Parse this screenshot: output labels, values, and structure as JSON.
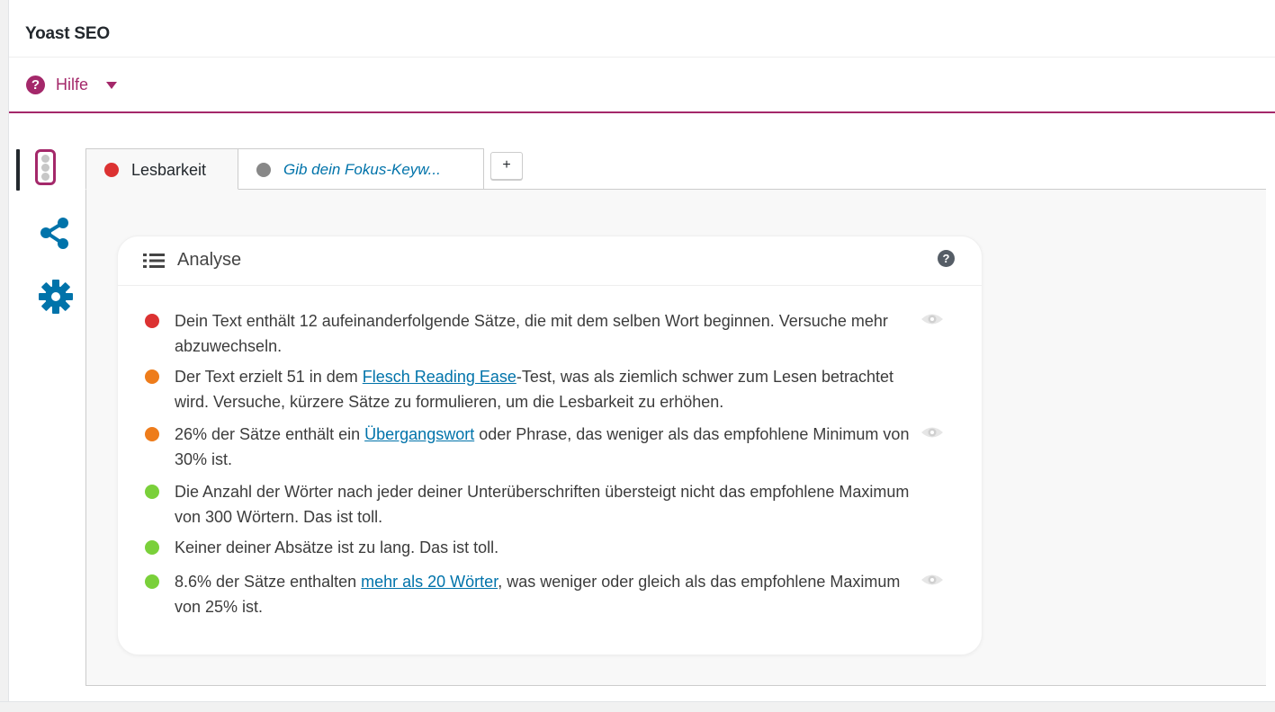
{
  "window": {
    "title": "Yoast SEO"
  },
  "help": {
    "label": "Hilfe",
    "icon": "question-circle-icon"
  },
  "side_nav": {
    "items": [
      {
        "name": "readability-traffic-light-icon",
        "active": true
      },
      {
        "name": "share-icon",
        "active": false
      },
      {
        "name": "gear-icon",
        "active": false
      }
    ]
  },
  "tabs": [
    {
      "label": "Lesbarkeit",
      "status_color": "#dc3232",
      "active": true
    },
    {
      "label": "Gib dein Fokus-Keyw...",
      "status_color": "#888888",
      "active": false
    }
  ],
  "add_tab_label": "+",
  "analysis": {
    "title": "Analyse",
    "help_glyph": "?",
    "results": [
      {
        "status_color": "#dc3232",
        "before": "Dein Text enthält 12 aufeinanderfolgende Sätze, die mit dem selben Wort beginnen. Versuche mehr abzuwechseln.",
        "link": "",
        "after": "",
        "has_eye": true
      },
      {
        "status_color": "#ee7c1b",
        "before": "Der Text erzielt 51 in dem ",
        "link": "Flesch Reading Ease",
        "after": "-Test, was als ziemlich schwer zum Lesen betrachtet wird. Versuche, kürzere Sätze zu formulieren, um die Lesbarkeit zu erhöhen.",
        "has_eye": false
      },
      {
        "status_color": "#ee7c1b",
        "before": "26% der Sätze enthält ein ",
        "link": "Übergangswort",
        "after": " oder Phrase, das weniger als das empfohlene Minimum von 30% ist.",
        "has_eye": true
      },
      {
        "status_color": "#7ad03a",
        "before": "Die Anzahl der Wörter nach jeder deiner Unterüberschriften übersteigt nicht das empfohlene Maximum von 300 Wörtern. Das ist toll.",
        "link": "",
        "after": "",
        "has_eye": false
      },
      {
        "status_color": "#7ad03a",
        "before": "Keiner deiner Absätze ist zu lang. Das ist toll.",
        "link": "",
        "after": "",
        "has_eye": false
      },
      {
        "status_color": "#7ad03a",
        "before": "8.6% der Sätze enthalten ",
        "link": "mehr als 20 Wörter",
        "after": ", was weniger oder gleich als das empfohlene Maximum von 25% ist.",
        "has_eye": true
      }
    ]
  },
  "colors": {
    "accent": "#a4286a",
    "link": "#0073aa",
    "icon_blue": "#0073aa"
  }
}
